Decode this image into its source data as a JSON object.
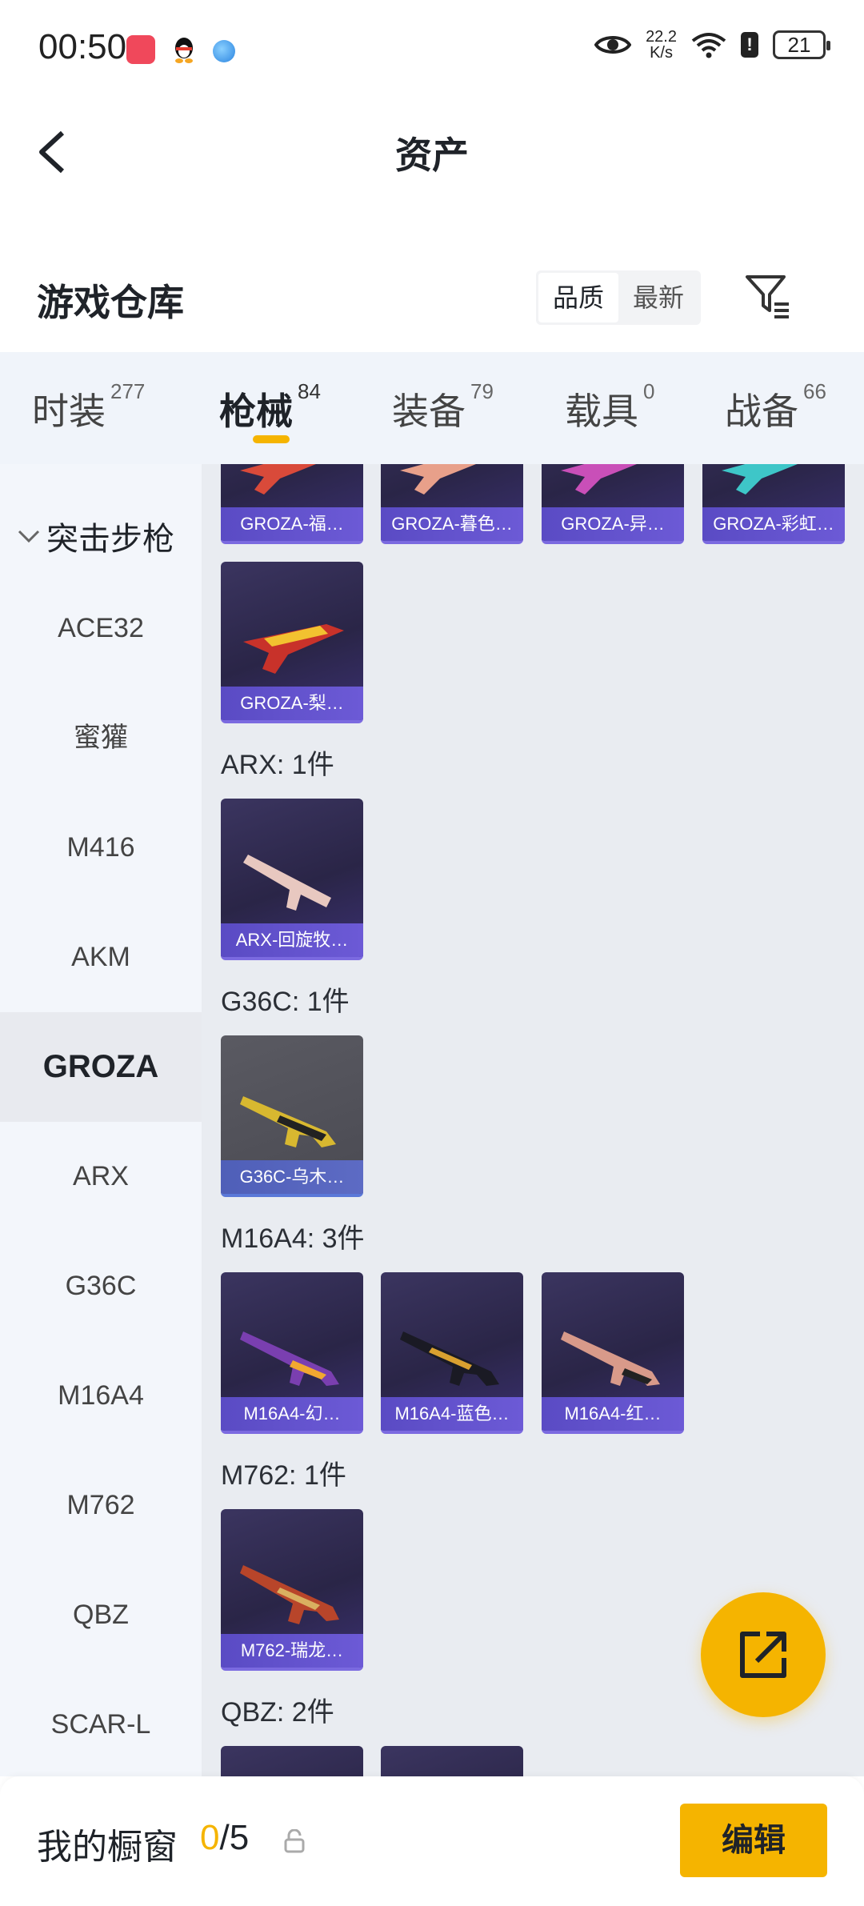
{
  "status_bar": {
    "time": "00:50",
    "net_speed_value": "22.2",
    "net_speed_unit": "K/s",
    "battery": "21",
    "icons": [
      "app-notification-icon",
      "qq-icon",
      "browser-icon",
      "eye-icon",
      "wifi-icon",
      "alert-icon",
      "battery-icon"
    ]
  },
  "nav": {
    "title": "资产",
    "back_icon": "chevron-left-icon"
  },
  "warehouse": {
    "title": "游戏仓库",
    "sort_options": [
      "品质",
      "最新"
    ],
    "sort_selected": "品质",
    "filter_icon": "filter-icon"
  },
  "tabs": [
    {
      "label": "时装",
      "count": "277"
    },
    {
      "label": "枪械",
      "count": "84",
      "active": true
    },
    {
      "label": "装备",
      "count": "79"
    },
    {
      "label": "载具",
      "count": "0"
    },
    {
      "label": "战备",
      "count": "66"
    }
  ],
  "sidebar": {
    "group": "突击步枪",
    "items": [
      "ACE32",
      "蜜獾",
      "M416",
      "AKM",
      "GROZA",
      "ARX",
      "G36C",
      "M16A4",
      "M762",
      "QBZ",
      "SCAR-L"
    ],
    "active": "GROZA"
  },
  "content": {
    "top_row": [
      "GROZA-福…",
      "GROZA-暮色…",
      "GROZA-异…",
      "GROZA-彩虹…"
    ],
    "groza_extra": [
      "GROZA-梨…"
    ],
    "groups": [
      {
        "label": "ARX: 1件",
        "items": [
          "ARX-回旋牧…"
        ]
      },
      {
        "label": "G36C: 1件",
        "items": [
          "G36C-乌木…"
        ]
      },
      {
        "label": "M16A4: 3件",
        "items": [
          "M16A4-幻…",
          "M16A4-蓝色…",
          "M16A4-红…"
        ]
      },
      {
        "label": "M762: 1件",
        "items": [
          "M762-瑞龙…"
        ]
      },
      {
        "label": "QBZ: 2件",
        "items": []
      }
    ]
  },
  "fab": {
    "icon": "share-icon"
  },
  "bottom": {
    "showcase_label": "我的橱窗",
    "showcase_current": "0",
    "showcase_total": "/5",
    "lock_icon": "lock-icon",
    "edit_label": "编辑"
  },
  "colors": {
    "accent": "#f5b400",
    "card_bg": "#2a2547",
    "card_caption": "#5a4bc4"
  }
}
